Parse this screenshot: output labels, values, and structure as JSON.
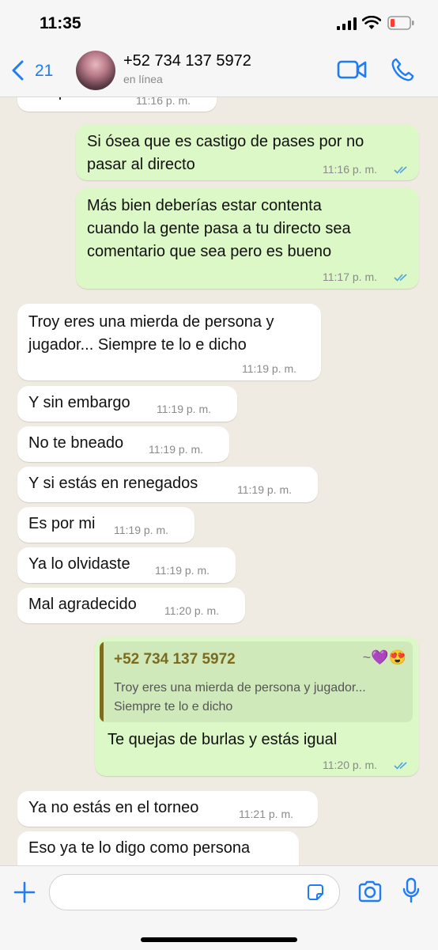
{
  "status": {
    "time": "11:35"
  },
  "header": {
    "back_count": "21",
    "contact_name": "+52 734 137 5972",
    "contact_status": "en línea"
  },
  "messages": [
    {
      "dir": "in",
      "text": "De q hablas",
      "time": "11:16 p. m."
    },
    {
      "dir": "out",
      "lines": [
        "Si ósea que es castigo de pases por no",
        "pasar al directo"
      ],
      "time": "11:16 p. m."
    },
    {
      "dir": "out",
      "lines": [
        "Más bien deberías estar contenta",
        "cuando la gente pasa a tu directo sea",
        "comentario que sea pero es bueno"
      ],
      "time": "11:17 p. m."
    },
    {
      "dir": "in",
      "lines": [
        "Troy eres una mierda de persona y",
        "jugador... Siempre te lo e dicho"
      ],
      "time": "11:19 p. m."
    },
    {
      "dir": "in",
      "text": "Y sin embargo",
      "time": "11:19 p. m."
    },
    {
      "dir": "in",
      "text": "No te bneado",
      "time": "11:19 p. m."
    },
    {
      "dir": "in",
      "text": "Y si estás en renegados",
      "time": "11:19 p. m."
    },
    {
      "dir": "in",
      "text": "Es por mi",
      "time": "11:19 p. m."
    },
    {
      "dir": "in",
      "text": "Ya lo olvidaste",
      "time": "11:19 p. m."
    },
    {
      "dir": "in",
      "text": "Mal agradecido",
      "time": "11:20 p. m."
    },
    {
      "dir": "out",
      "quote": {
        "name": "+52 734 137 5972",
        "tag": "~💜😍",
        "lines": [
          "Troy eres una mierda de persona y jugador...",
          "Siempre te lo e dicho"
        ]
      },
      "text": "Te quejas de burlas y estás igual",
      "time": "11:20 p. m."
    },
    {
      "dir": "in",
      "text": "Ya no estás en el torneo",
      "time": "11:21 p. m."
    },
    {
      "dir": "in",
      "text": "Eso ya te lo digo como persona",
      "time": ""
    }
  ],
  "colors": {
    "accent": "#1f7cf5",
    "outgoing": "#dcf8c6",
    "incoming": "#ffffff",
    "read_ticks": "#4fa3e0"
  },
  "icons": [
    "back-chevron-icon",
    "video-call-icon",
    "phone-icon",
    "plus-icon",
    "sticker-icon",
    "camera-icon",
    "microphone-icon",
    "signal-icon",
    "wifi-icon",
    "battery-icon"
  ]
}
